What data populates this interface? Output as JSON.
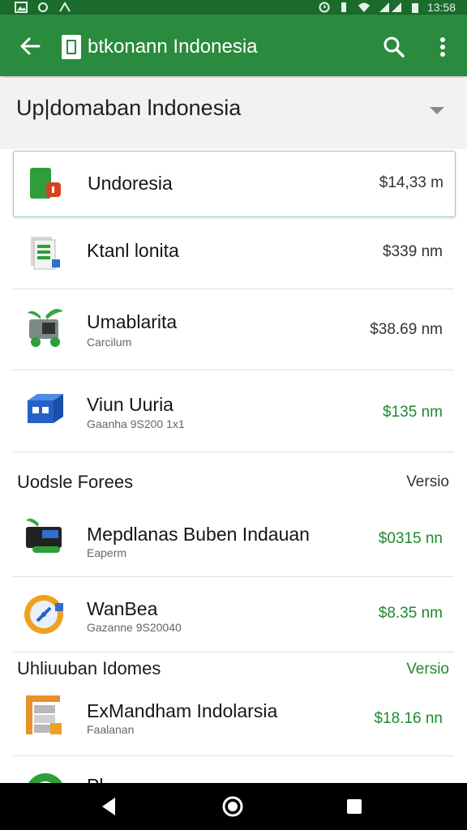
{
  "status_bar": {
    "time": "13:58",
    "left_icons": [
      "image-icon",
      "sync-icon",
      "n-icon"
    ],
    "right_icons": [
      "alarm-icon",
      "vibrate-icon",
      "wifi-icon",
      "signal-icon",
      "battery-icon"
    ]
  },
  "app_bar": {
    "title": "btkonann Indonesia",
    "color": "#2a8a3d"
  },
  "section": {
    "title": "Up|domaban lndonesia"
  },
  "items_top": [
    {
      "name": "Undoresia",
      "sub": "",
      "price": "$14,33 m",
      "price_color": "dark",
      "icon": "app-icon-red-green"
    },
    {
      "name": "Ktanl lonita",
      "sub": "",
      "price": "$339 nm",
      "price_color": "dark",
      "icon": "document-stack-icon"
    },
    {
      "name": "Umablarita",
      "sub": "Carcilum",
      "price": "$38.69 nm",
      "price_color": "dark",
      "icon": "plant-cart-icon"
    },
    {
      "name": "Viun Uuria",
      "sub": "Gaanha 9S200 1x1",
      "price": "$135 nm",
      "price_color": "green",
      "icon": "blue-box-icon"
    }
  ],
  "group1": {
    "header": "Uodsle Forees",
    "right": "Versio"
  },
  "items_mid": [
    {
      "name": "Mepdlanas Buben Indauan",
      "sub": "Eaperm",
      "price": "$0315 nn",
      "price_color": "green",
      "icon": "machine-plant-icon"
    },
    {
      "name": "WanBea",
      "sub": "Gazanne 9S20040",
      "price": "$8.35 nm",
      "price_color": "green",
      "icon": "compass-badge-icon"
    }
  ],
  "group2": {
    "header": "Uhliuuban Idomes",
    "right": "Versio"
  },
  "items_bottom": [
    {
      "name": "ExMandham Indolarsia",
      "sub": "Faalanan",
      "price": "$18.16 nn",
      "price_color": "green",
      "icon": "orange-shelf-icon"
    }
  ],
  "partial_item": {
    "name": "Pl..."
  },
  "nav_bar": {
    "buttons": [
      "back-triangle-icon",
      "home-circle-icon",
      "recents-square-icon"
    ]
  },
  "colors": {
    "primary": "#2a8a3d",
    "status_bar": "#1b6b2c",
    "price_green": "#1f8a2e"
  }
}
